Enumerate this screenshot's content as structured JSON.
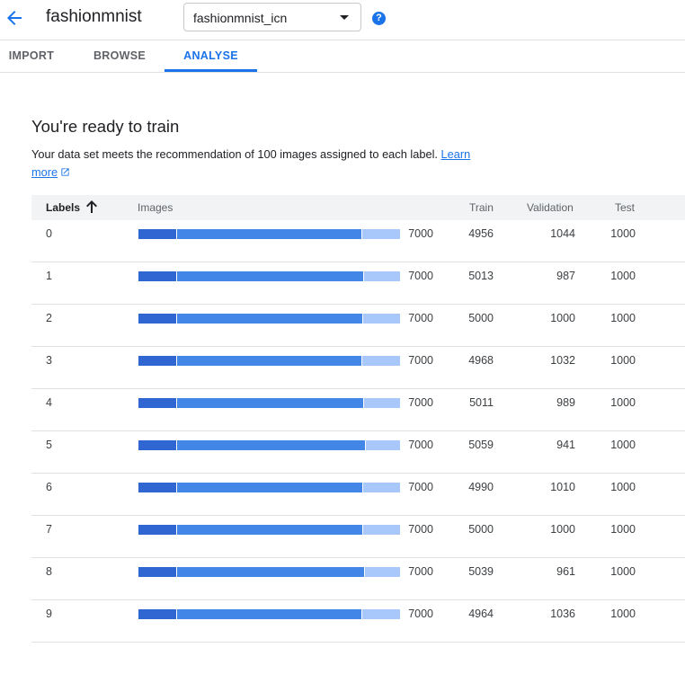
{
  "header": {
    "back_icon": "arrow-back-icon",
    "title": "fashionmnist",
    "dataset_select": "fashionmnist_icn",
    "help_icon": "help-icon",
    "help_glyph": "?"
  },
  "tabs": [
    {
      "label": "IMPORT",
      "active": false
    },
    {
      "label": "BROWSE",
      "active": false
    },
    {
      "label": "ANALYSE",
      "active": true
    }
  ],
  "main": {
    "heading": "You're ready to train",
    "description": "Your data set meets the recommendation of 100 images assigned to each label.",
    "learn_more": "Learn more"
  },
  "table": {
    "headers": {
      "labels": "Labels",
      "images": "Images",
      "train": "Train",
      "validation": "Validation",
      "test": "Test"
    },
    "rows": [
      {
        "label": "0",
        "images": "7000",
        "train": "4956",
        "validation": "1044",
        "test": "1000"
      },
      {
        "label": "1",
        "images": "7000",
        "train": "5013",
        "validation": "987",
        "test": "1000"
      },
      {
        "label": "2",
        "images": "7000",
        "train": "5000",
        "validation": "1000",
        "test": "1000"
      },
      {
        "label": "3",
        "images": "7000",
        "train": "4968",
        "validation": "1032",
        "test": "1000"
      },
      {
        "label": "4",
        "images": "7000",
        "train": "5011",
        "validation": "989",
        "test": "1000"
      },
      {
        "label": "5",
        "images": "7000",
        "train": "5059",
        "validation": "941",
        "test": "1000"
      },
      {
        "label": "6",
        "images": "7000",
        "train": "4990",
        "validation": "1010",
        "test": "1000"
      },
      {
        "label": "7",
        "images": "7000",
        "train": "5000",
        "validation": "1000",
        "test": "1000"
      },
      {
        "label": "8",
        "images": "7000",
        "train": "5039",
        "validation": "961",
        "test": "1000"
      },
      {
        "label": "9",
        "images": "7000",
        "train": "4964",
        "validation": "1036",
        "test": "1000"
      }
    ]
  },
  "colors": {
    "accent": "#1a73e8",
    "bar_test": "#2f66d2",
    "bar_train": "#4286e8",
    "bar_validation": "#a8c7fa"
  }
}
